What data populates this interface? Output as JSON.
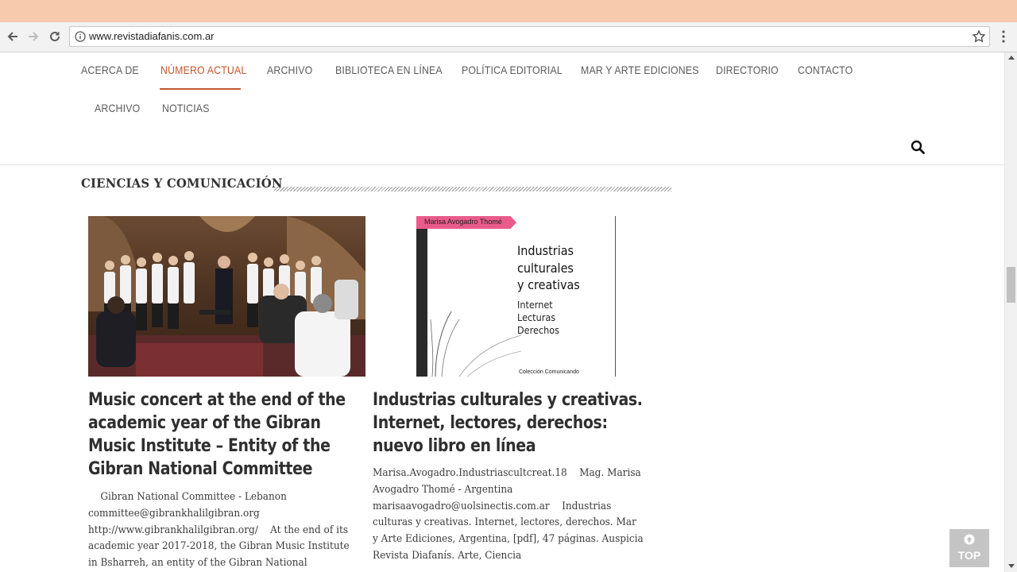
{
  "browser": {
    "url": "www.revistadiafanis.com.ar"
  },
  "nav": {
    "items": [
      {
        "label": "ACERCA DE"
      },
      {
        "label": "NÚMERO ACTUAL"
      },
      {
        "label": "ARCHIVO"
      },
      {
        "label": "BIBLIOTECA EN LÍNEA"
      },
      {
        "label": "POLÍTICA EDITORIAL"
      },
      {
        "label": "MAR Y ARTE EDICIONES"
      },
      {
        "label": "DIRECTORIO"
      },
      {
        "label": "CONTACTO"
      },
      {
        "label": "ARCHIVO"
      },
      {
        "label": "NOTICIAS"
      }
    ],
    "active_color": "#c2562e"
  },
  "section": {
    "title": "CIENCIAS Y COMUNICACIÓN"
  },
  "posts": [
    {
      "title": "Music concert at the end of the academic year of the Gibran Music Institute – Entity of the Gibran National Committee",
      "excerpt": "    Gibran National Committee - Lebanon committee@gibrankhalilgibran.org http://www.gibrankhalilgibran.org/    At the end of its academic year 2017-2018, the Gibran Music Institute in Bsharreh, an entity of the Gibran National Committee,"
    },
    {
      "title": "Industrias culturales y creativas. Internet, lectores, derechos: nuevo libro en línea",
      "excerpt": "Marisa.Avogadro.Industriascultcreat.18    Mag. Marisa Avogadro Thomé - Argentina marisaavogadro@uolsinectis.com.ar    Industrias culturas y creativas. Internet, lectores, derechos. Mar y Arte Ediciones, Argentina, [pdf], 47 páginas. Auspicia Revista Diafanís. Arte, Ciencia",
      "cover": {
        "tag": "Marisa Avogadro Thomé",
        "title_lines": [
          "Industrias",
          "culturales",
          "y creativas"
        ],
        "subtitle_lines": [
          "Internet",
          "Lecturas",
          "Derechos"
        ],
        "collection": "Colección Comunicando",
        "tag_color": "#e95b8b"
      }
    }
  ],
  "top_button": {
    "label": "TOP"
  }
}
